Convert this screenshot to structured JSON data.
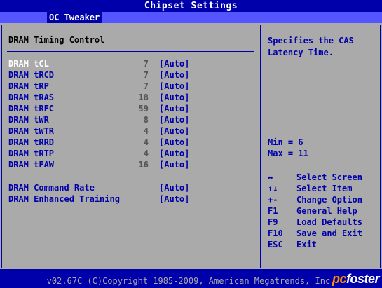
{
  "window": {
    "title": "Chipset Settings"
  },
  "tab": {
    "label": "OC Tweaker"
  },
  "section": {
    "title": "DRAM Timing Control"
  },
  "timings": [
    {
      "name": "DRAM tCL",
      "number": "7",
      "value": "[Auto]",
      "selected": true
    },
    {
      "name": "DRAM tRCD",
      "number": "7",
      "value": "[Auto]"
    },
    {
      "name": "DRAM tRP",
      "number": "7",
      "value": "[Auto]"
    },
    {
      "name": "DRAM tRAS",
      "number": "18",
      "value": "[Auto]"
    },
    {
      "name": "DRAM tRFC",
      "number": "59",
      "value": "[Auto]"
    },
    {
      "name": "DRAM tWR",
      "number": "8",
      "value": "[Auto]"
    },
    {
      "name": "DRAM tWTR",
      "number": "4",
      "value": "[Auto]"
    },
    {
      "name": "DRAM tRRD",
      "number": "4",
      "value": "[Auto]"
    },
    {
      "name": "DRAM tRTP",
      "number": "4",
      "value": "[Auto]"
    },
    {
      "name": "DRAM tFAW",
      "number": "16",
      "value": "[Auto]"
    }
  ],
  "extra_settings": [
    {
      "name": "DRAM Command Rate",
      "value": "[Auto]"
    },
    {
      "name": "DRAM Enhanced Training",
      "value": "[Auto]"
    }
  ],
  "help": {
    "description": "Specifies the CAS Latency Time.",
    "min": "Min = 6",
    "max": "Max = 11"
  },
  "keys": [
    {
      "key": "↔",
      "desc": "Select Screen"
    },
    {
      "key": "↑↓",
      "desc": "Select Item"
    },
    {
      "key": "+-",
      "desc": "Change Option"
    },
    {
      "key": "F1",
      "desc": "General Help"
    },
    {
      "key": "F9",
      "desc": "Load Defaults"
    },
    {
      "key": "F10",
      "desc": "Save and Exit"
    },
    {
      "key": "ESC",
      "desc": "Exit"
    }
  ],
  "footer": {
    "copyright": "v02.67C (C)Copyright 1985-2009, American Megatrends, Inc.",
    "watermark_pc": "pc",
    "watermark_rest": "foster"
  },
  "colors": {
    "bios_blue": "#0000aa",
    "panel_gray": "#aaaaaa",
    "tab_bar": "#5555ff",
    "selected_text": "#ffffff",
    "number_gray": "#555555"
  }
}
